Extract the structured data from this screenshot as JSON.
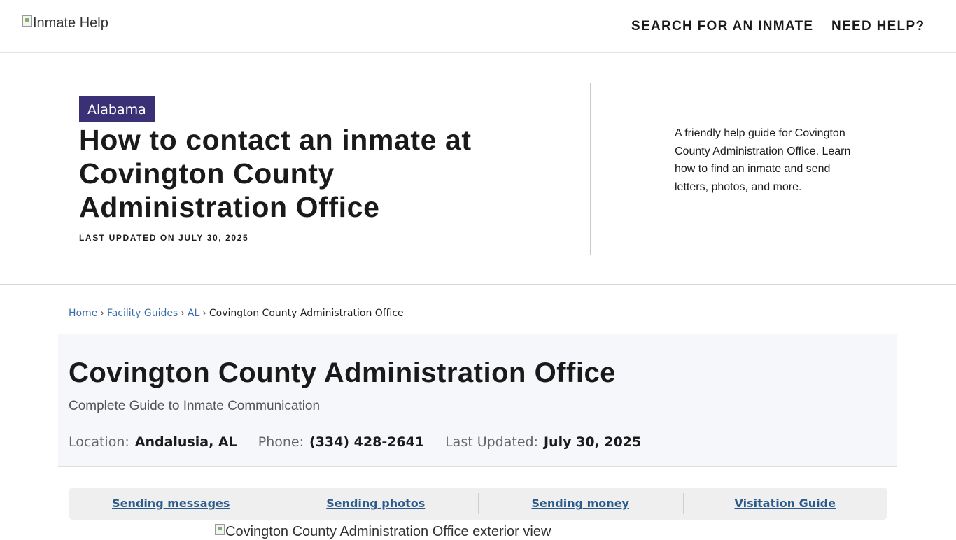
{
  "header": {
    "logo_alt": "Inmate Help",
    "nav": [
      {
        "label": "SEARCH FOR AN INMATE"
      },
      {
        "label": "NEED HELP?"
      }
    ]
  },
  "hero": {
    "state_badge": "Alabama",
    "title": "How to contact an inmate at Covington County Administration Office",
    "last_updated": "LAST UPDATED ON JULY 30, 2025",
    "blurb": "A friendly help guide for Covington County Administration Office. Learn how to find an inmate and send letters, photos, and more."
  },
  "breadcrumb": {
    "items": [
      {
        "label": "Home"
      },
      {
        "label": "Facility Guides"
      },
      {
        "label": "AL"
      },
      {
        "label": "Covington County Administration Office"
      }
    ],
    "separator": "›"
  },
  "facility": {
    "title": "Covington County Administration Office",
    "subtitle": "Complete Guide to Inmate Communication",
    "meta": {
      "location_label": "Location:",
      "location_value": "Andalusia, AL",
      "phone_label": "Phone:",
      "phone_value": "(334) 428-2641",
      "updated_label": "Last Updated:",
      "updated_value": "July 30, 2025"
    }
  },
  "guide_tabs": [
    {
      "label": "Sending messages"
    },
    {
      "label": "Sending photos"
    },
    {
      "label": "Sending money"
    },
    {
      "label": "Visitation Guide"
    }
  ],
  "exterior_image_alt": "Covington County Administration Office exterior view",
  "colors": {
    "badge_bg": "#3a3075",
    "link": "#3b6ea8",
    "tab_link": "#2b5b8c",
    "card_bg": "#f5f7fa"
  }
}
